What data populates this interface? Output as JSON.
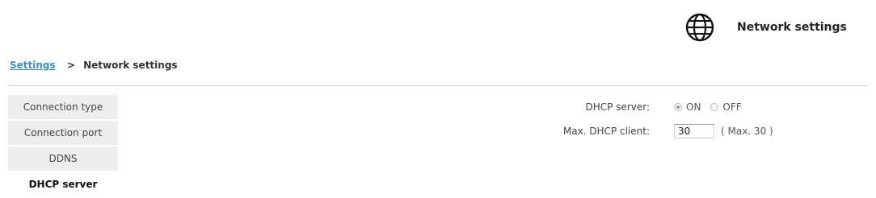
{
  "header": {
    "title": "Network settings",
    "icon": "globe-icon"
  },
  "breadcrumb": {
    "root": "Settings",
    "separator": ">",
    "current": "Network settings"
  },
  "sidebar": {
    "items": [
      {
        "label": "Connection type",
        "active": false
      },
      {
        "label": "Connection port",
        "active": false
      },
      {
        "label": "DDNS",
        "active": false
      },
      {
        "label": "DHCP server",
        "active": true
      }
    ]
  },
  "form": {
    "dhcp_server": {
      "label": "DHCP server:",
      "on_label": "ON",
      "off_label": "OFF",
      "selected": "ON"
    },
    "max_clients": {
      "label": "Max. DHCP client:",
      "value": "30",
      "hint": "( Max. 30 )"
    }
  },
  "colors": {
    "link": "#3b8fc7",
    "sidebar_bg": "#eeeeee",
    "divider": "#cfcfcf"
  }
}
